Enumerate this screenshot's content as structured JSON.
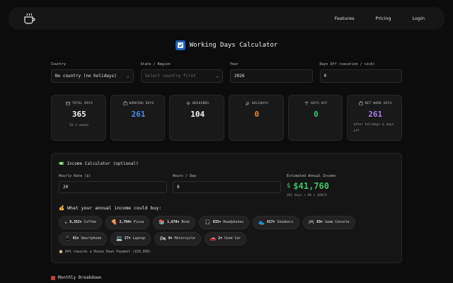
{
  "nav": {
    "features": "Features",
    "pricing": "Pricing",
    "login": "Login"
  },
  "page": {
    "title": "Working Days Calculator"
  },
  "inputs": {
    "country": {
      "label": "Country",
      "value": "No country (no holidays)"
    },
    "state": {
      "label": "State / Region",
      "placeholder": "Select country first"
    },
    "year": {
      "label": "Year",
      "value": "2026"
    },
    "days_off": {
      "label": "Days Off (vacation / sick)",
      "value": "0"
    }
  },
  "stats": [
    {
      "label": "TOTAL DAYS",
      "value": "365",
      "sub": "52.1 weeks",
      "color": "#f2f2f2",
      "icon": "calendar-icon"
    },
    {
      "label": "WORKING DAYS",
      "value": "261",
      "sub": "",
      "color": "#4d8ee8",
      "icon": "briefcase-icon"
    },
    {
      "label": "WEEKENDS",
      "value": "104",
      "sub": "",
      "color": "#f2f2f2",
      "icon": "sun-icon"
    },
    {
      "label": "HOLIDAYS",
      "value": "0",
      "sub": "",
      "color": "#e8843a",
      "icon": "party-icon"
    },
    {
      "label": "DAYS OFF",
      "value": "0",
      "sub": "",
      "color": "#3ec26a",
      "icon": "palm-tree-icon"
    },
    {
      "label": "NET WORK DAYS",
      "value": "261",
      "sub": "after holidays & days off",
      "color": "#a97bf0",
      "icon": "briefcase-icon"
    }
  ],
  "income": {
    "title": "Income Calculator (optional)",
    "hourly": {
      "label": "Hourly Rate ($)",
      "value": "20"
    },
    "hours": {
      "label": "Hours / Day",
      "value": "8"
    },
    "annual": {
      "label": "Estimated Annual Income",
      "symbol": "$",
      "value": "$41,760",
      "sub": "261 days × 8h × $20/h"
    },
    "buy_title": "What your annual income could buy:",
    "items": [
      {
        "icon": "☕",
        "count": "8,352×",
        "name": "Coffee"
      },
      {
        "icon": "🍕",
        "count": "2,784×",
        "name": "Pizza"
      },
      {
        "icon": "📚",
        "count": "1,670×",
        "name": "Book"
      },
      {
        "icon": "🎧",
        "count": "835×",
        "name": "Headphones"
      },
      {
        "icon": "👟",
        "count": "417×",
        "name": "Sneakers"
      },
      {
        "icon": "🎮",
        "count": "83×",
        "name": "Game Console"
      },
      {
        "icon": "📱",
        "count": "41×",
        "name": "Smartphone"
      },
      {
        "icon": "💻",
        "count": "27×",
        "name": "Laptop"
      },
      {
        "icon": "🏍",
        "count": "8×",
        "name": "Motorcycle"
      },
      {
        "icon": "🚗",
        "count": "2×",
        "name": "Used Car"
      }
    ],
    "house": "84% towards a House Down Payment ($50,000)"
  },
  "monthly": {
    "title": "Monthly Breakdown"
  }
}
